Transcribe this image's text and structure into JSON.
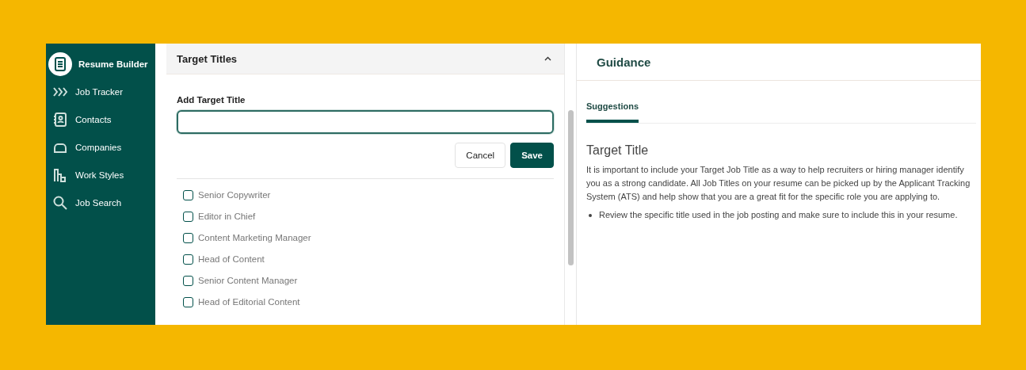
{
  "sidebar": {
    "items": [
      {
        "label": "Resume Builder",
        "selected": true,
        "kind": "doc"
      },
      {
        "label": "Job Tracker",
        "selected": false,
        "kind": "chevrons"
      },
      {
        "label": "Contacts",
        "selected": false,
        "kind": "contact"
      },
      {
        "label": "Companies",
        "selected": false,
        "kind": "cloud"
      },
      {
        "label": "Work Styles",
        "selected": false,
        "kind": "bars"
      },
      {
        "label": "Job Search",
        "selected": false,
        "kind": "search"
      }
    ]
  },
  "section": {
    "title": "Target Titles",
    "expanded": true,
    "field": {
      "label": "Add Target Title"
    },
    "buttons": [
      {
        "label": "Cancel",
        "kind": "secondary"
      },
      {
        "label": "Save",
        "kind": "primary"
      }
    ],
    "options": [
      {
        "label": "Senior Copywriter",
        "checked": false
      },
      {
        "label": "Editor in Chief",
        "checked": false
      },
      {
        "label": "Content Marketing Manager",
        "checked": false
      },
      {
        "label": "Head of Content",
        "checked": false
      },
      {
        "label": "Senior Content Manager",
        "checked": false
      },
      {
        "label": "Head of Editorial Content",
        "checked": false
      }
    ]
  },
  "guidance": {
    "title": "Guidance",
    "tabs": [
      {
        "label": "Suggestions",
        "selected": true
      }
    ],
    "heading": "Target Title",
    "paragraph": "It is important to include your Target Job Title as a way to help recruiters or hiring manager identify you as a strong candidate. All Job Titles on your resume can be picked up by the Applicant Tracking System (ATS) and help show that you are a great fit for the specific role you are applying to.",
    "bullets": [
      "Review the specific title used in the job posting and make sure to include this in your resume."
    ]
  }
}
